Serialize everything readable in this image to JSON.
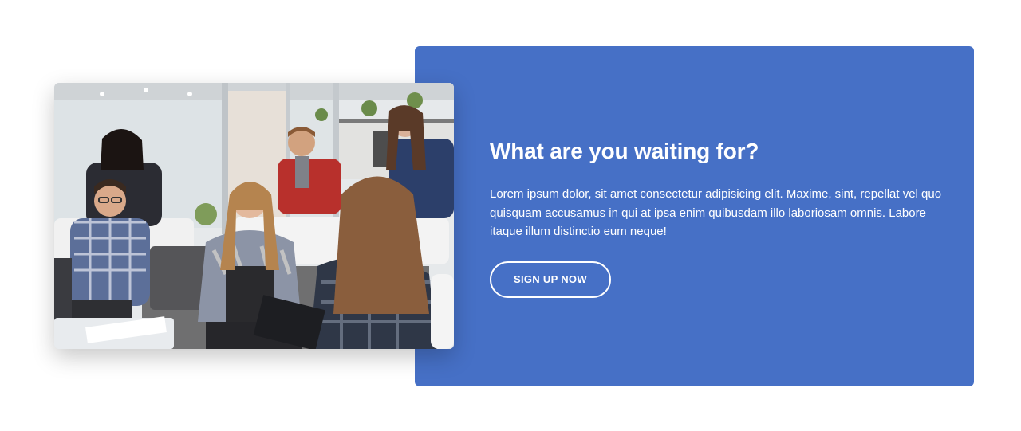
{
  "theme": {
    "panel_color": "#4670c6",
    "text_color": "#ffffff"
  },
  "image": {
    "icon": "team-meeting-photo"
  },
  "cta": {
    "title": "What are you waiting for?",
    "text": "Lorem ipsum dolor, sit amet consectetur adipisicing elit. Maxime, sint, repellat vel quo quisquam accusamus in qui at ipsa enim quibusdam illo laboriosam omnis. Labore itaque illum distinctio eum neque!",
    "button_label": "SIGN UP NOW"
  }
}
